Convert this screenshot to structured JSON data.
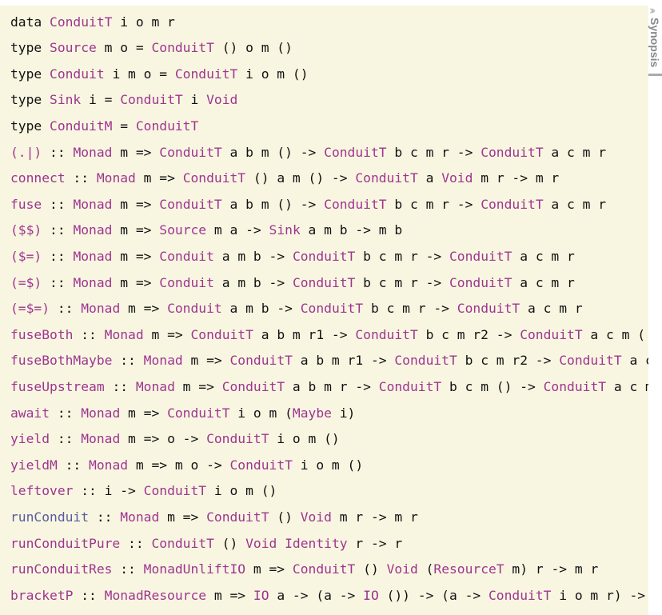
{
  "synopsis_tab": {
    "label": "Synopsis",
    "icon": "double-chevron-right-icon"
  },
  "colors": {
    "background": "#f8f6e1",
    "link": "#9e358f",
    "visited_link": "#5b5a9e",
    "text": "#111111"
  },
  "lines": [
    [
      [
        "data ",
        ""
      ],
      [
        "ConduitT",
        "link"
      ],
      [
        " i o m r",
        ""
      ]
    ],
    [
      [
        "type ",
        ""
      ],
      [
        "Source",
        "link"
      ],
      [
        " m o = ",
        ""
      ],
      [
        "ConduitT",
        "link"
      ],
      [
        " () o m ()",
        ""
      ]
    ],
    [
      [
        "type ",
        ""
      ],
      [
        "Conduit",
        "link"
      ],
      [
        " i m o = ",
        ""
      ],
      [
        "ConduitT",
        "link"
      ],
      [
        " i o m ()",
        ""
      ]
    ],
    [
      [
        "type ",
        ""
      ],
      [
        "Sink",
        "link"
      ],
      [
        " i = ",
        ""
      ],
      [
        "ConduitT",
        "link"
      ],
      [
        " i ",
        ""
      ],
      [
        "Void",
        "link"
      ]
    ],
    [
      [
        "type ",
        ""
      ],
      [
        "ConduitM",
        "link"
      ],
      [
        " = ",
        ""
      ],
      [
        "ConduitT",
        "link"
      ]
    ],
    [
      [
        "(.|)",
        "link"
      ],
      [
        " :: ",
        ""
      ],
      [
        "Monad",
        "link"
      ],
      [
        " m => ",
        ""
      ],
      [
        "ConduitT",
        "link"
      ],
      [
        " a b m () -> ",
        ""
      ],
      [
        "ConduitT",
        "link"
      ],
      [
        " b c m r -> ",
        ""
      ],
      [
        "ConduitT",
        "link"
      ],
      [
        " a c m r",
        ""
      ]
    ],
    [
      [
        "connect",
        "link"
      ],
      [
        " :: ",
        ""
      ],
      [
        "Monad",
        "link"
      ],
      [
        " m => ",
        ""
      ],
      [
        "ConduitT",
        "link"
      ],
      [
        " () a m () -> ",
        ""
      ],
      [
        "ConduitT",
        "link"
      ],
      [
        " a ",
        ""
      ],
      [
        "Void",
        "link"
      ],
      [
        " m r -> m r",
        ""
      ]
    ],
    [
      [
        "fuse",
        "link"
      ],
      [
        " :: ",
        ""
      ],
      [
        "Monad",
        "link"
      ],
      [
        " m => ",
        ""
      ],
      [
        "ConduitT",
        "link"
      ],
      [
        " a b m () -> ",
        ""
      ],
      [
        "ConduitT",
        "link"
      ],
      [
        " b c m r -> ",
        ""
      ],
      [
        "ConduitT",
        "link"
      ],
      [
        " a c m r",
        ""
      ]
    ],
    [
      [
        "($$)",
        "link"
      ],
      [
        " :: ",
        ""
      ],
      [
        "Monad",
        "link"
      ],
      [
        " m => ",
        ""
      ],
      [
        "Source",
        "link"
      ],
      [
        " m a -> ",
        ""
      ],
      [
        "Sink",
        "link"
      ],
      [
        " a m b -> m b",
        ""
      ]
    ],
    [
      [
        "($=)",
        "link"
      ],
      [
        " :: ",
        ""
      ],
      [
        "Monad",
        "link"
      ],
      [
        " m => ",
        ""
      ],
      [
        "Conduit",
        "link"
      ],
      [
        " a m b -> ",
        ""
      ],
      [
        "ConduitT",
        "link"
      ],
      [
        " b c m r -> ",
        ""
      ],
      [
        "ConduitT",
        "link"
      ],
      [
        " a c m r",
        ""
      ]
    ],
    [
      [
        "(=$)",
        "link"
      ],
      [
        " :: ",
        ""
      ],
      [
        "Monad",
        "link"
      ],
      [
        " m => ",
        ""
      ],
      [
        "Conduit",
        "link"
      ],
      [
        " a m b -> ",
        ""
      ],
      [
        "ConduitT",
        "link"
      ],
      [
        " b c m r -> ",
        ""
      ],
      [
        "ConduitT",
        "link"
      ],
      [
        " a c m r",
        ""
      ]
    ],
    [
      [
        "(=$=)",
        "link"
      ],
      [
        " :: ",
        ""
      ],
      [
        "Monad",
        "link"
      ],
      [
        " m => ",
        ""
      ],
      [
        "Conduit",
        "link"
      ],
      [
        " a m b -> ",
        ""
      ],
      [
        "ConduitT",
        "link"
      ],
      [
        " b c m r -> ",
        ""
      ],
      [
        "ConduitT",
        "link"
      ],
      [
        " a c m r",
        ""
      ]
    ],
    [
      [
        "fuseBoth",
        "link"
      ],
      [
        " :: ",
        ""
      ],
      [
        "Monad",
        "link"
      ],
      [
        " m => ",
        ""
      ],
      [
        "ConduitT",
        "link"
      ],
      [
        " a b m r1 -> ",
        ""
      ],
      [
        "ConduitT",
        "link"
      ],
      [
        " b c m r2 -> ",
        ""
      ],
      [
        "ConduitT",
        "link"
      ],
      [
        " a c m (",
        ""
      ]
    ],
    [
      [
        "fuseBothMaybe",
        "link"
      ],
      [
        " :: ",
        ""
      ],
      [
        "Monad",
        "link"
      ],
      [
        " m => ",
        ""
      ],
      [
        "ConduitT",
        "link"
      ],
      [
        " a b m r1 -> ",
        ""
      ],
      [
        "ConduitT",
        "link"
      ],
      [
        " b c m r2 -> ",
        ""
      ],
      [
        "ConduitT",
        "link"
      ],
      [
        " a c",
        ""
      ]
    ],
    [
      [
        "fuseUpstream",
        "link"
      ],
      [
        " :: ",
        ""
      ],
      [
        "Monad",
        "link"
      ],
      [
        " m => ",
        ""
      ],
      [
        "ConduitT",
        "link"
      ],
      [
        " a b m r -> ",
        ""
      ],
      [
        "ConduitT",
        "link"
      ],
      [
        " b c m () -> ",
        ""
      ],
      [
        "ConduitT",
        "link"
      ],
      [
        " a c m",
        ""
      ]
    ],
    [
      [
        "await",
        "link"
      ],
      [
        " :: ",
        ""
      ],
      [
        "Monad",
        "link"
      ],
      [
        " m => ",
        ""
      ],
      [
        "ConduitT",
        "link"
      ],
      [
        " i o m (",
        ""
      ],
      [
        "Maybe",
        "link"
      ],
      [
        " i)",
        ""
      ]
    ],
    [
      [
        "yield",
        "link"
      ],
      [
        " :: ",
        ""
      ],
      [
        "Monad",
        "link"
      ],
      [
        " m => o -> ",
        ""
      ],
      [
        "ConduitT",
        "link"
      ],
      [
        " i o m ()",
        ""
      ]
    ],
    [
      [
        "yieldM",
        "link"
      ],
      [
        " :: ",
        ""
      ],
      [
        "Monad",
        "link"
      ],
      [
        " m => m o -> ",
        ""
      ],
      [
        "ConduitT",
        "link"
      ],
      [
        " i o m ()",
        ""
      ]
    ],
    [
      [
        "leftover",
        "link"
      ],
      [
        " :: i -> ",
        ""
      ],
      [
        "ConduitT",
        "link"
      ],
      [
        " i o m ()",
        ""
      ]
    ],
    [
      [
        "runConduit",
        "visited"
      ],
      [
        " :: ",
        ""
      ],
      [
        "Monad",
        "link"
      ],
      [
        " m => ",
        ""
      ],
      [
        "ConduitT",
        "link"
      ],
      [
        " () ",
        ""
      ],
      [
        "Void",
        "link"
      ],
      [
        " m r -> m r",
        ""
      ]
    ],
    [
      [
        "runConduitPure",
        "link"
      ],
      [
        " :: ",
        ""
      ],
      [
        "ConduitT",
        "link"
      ],
      [
        " () ",
        ""
      ],
      [
        "Void",
        "link"
      ],
      [
        " ",
        ""
      ],
      [
        "Identity",
        "link"
      ],
      [
        " r -> r",
        ""
      ]
    ],
    [
      [
        "runConduitRes",
        "link"
      ],
      [
        " :: ",
        ""
      ],
      [
        "MonadUnliftIO",
        "link"
      ],
      [
        " m => ",
        ""
      ],
      [
        "ConduitT",
        "link"
      ],
      [
        " () ",
        ""
      ],
      [
        "Void",
        "link"
      ],
      [
        " (",
        ""
      ],
      [
        "ResourceT",
        "link"
      ],
      [
        " m) r -> m r",
        ""
      ]
    ],
    [
      [
        "bracketP",
        "link"
      ],
      [
        " :: ",
        ""
      ],
      [
        "MonadResource",
        "link"
      ],
      [
        " m => ",
        ""
      ],
      [
        "IO",
        "link"
      ],
      [
        " a -> (a -> ",
        ""
      ],
      [
        "IO",
        "link"
      ],
      [
        " ()) -> (a -> ",
        ""
      ],
      [
        "ConduitT",
        "link"
      ],
      [
        " i o m r) ->",
        ""
      ]
    ]
  ]
}
